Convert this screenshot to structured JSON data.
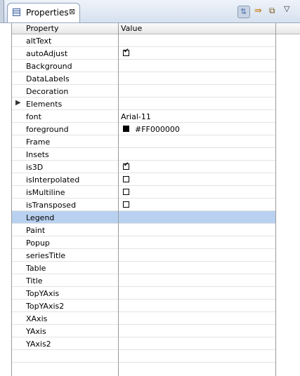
{
  "view": {
    "title": "Properties"
  },
  "columns": {
    "property": "Property",
    "value": "Value"
  },
  "toolbar": [
    {
      "icon": "tree-toggle-icon",
      "glyph": "⇅"
    },
    {
      "icon": "show-advanced-icon",
      "glyph": "⇛"
    },
    {
      "icon": "filter-icon",
      "glyph": "⧉"
    },
    {
      "icon": "view-menu-icon",
      "glyph": "▽"
    }
  ],
  "properties": [
    {
      "name": "altText",
      "type": "text",
      "value": ""
    },
    {
      "name": "autoAdjust",
      "type": "checkbox",
      "checked": true
    },
    {
      "name": "Background",
      "type": "text",
      "value": ""
    },
    {
      "name": "DataLabels",
      "type": "text",
      "value": ""
    },
    {
      "name": "Decoration",
      "type": "text",
      "value": ""
    },
    {
      "name": "Elements",
      "type": "group",
      "value": ""
    },
    {
      "name": "font",
      "type": "text",
      "value": "Arial-11"
    },
    {
      "name": "foreground",
      "type": "color",
      "value": "#FF000000",
      "swatch": "#000000"
    },
    {
      "name": "Frame",
      "type": "text",
      "value": ""
    },
    {
      "name": "Insets",
      "type": "text",
      "value": ""
    },
    {
      "name": "is3D",
      "type": "checkbox",
      "checked": true
    },
    {
      "name": "isInterpolated",
      "type": "checkbox",
      "checked": false
    },
    {
      "name": "isMultiline",
      "type": "checkbox",
      "checked": false
    },
    {
      "name": "isTransposed",
      "type": "checkbox",
      "checked": false
    },
    {
      "name": "Legend",
      "type": "text",
      "value": "",
      "selected": true
    },
    {
      "name": "Paint",
      "type": "text",
      "value": ""
    },
    {
      "name": "Popup",
      "type": "text",
      "value": ""
    },
    {
      "name": "seriesTitle",
      "type": "text",
      "value": ""
    },
    {
      "name": "Table",
      "type": "text",
      "value": ""
    },
    {
      "name": "Title",
      "type": "text",
      "value": ""
    },
    {
      "name": "TopYAxis",
      "type": "text",
      "value": ""
    },
    {
      "name": "TopYAxis2",
      "type": "text",
      "value": ""
    },
    {
      "name": "XAxis",
      "type": "text",
      "value": ""
    },
    {
      "name": "YAxis",
      "type": "text",
      "value": ""
    },
    {
      "name": "YAxis2",
      "type": "text",
      "value": ""
    },
    {
      "name": "",
      "type": "blank",
      "value": ""
    }
  ]
}
